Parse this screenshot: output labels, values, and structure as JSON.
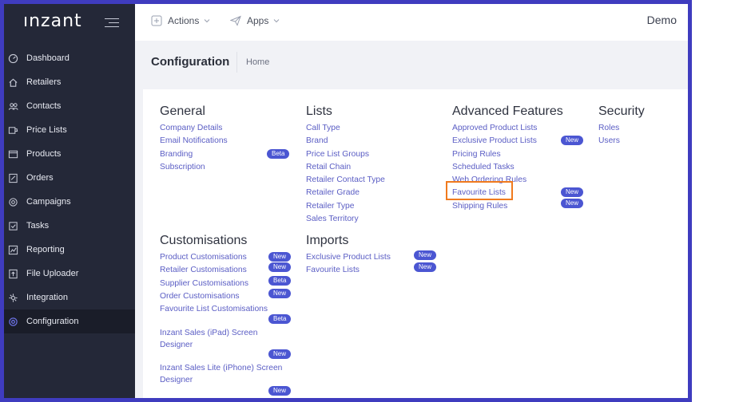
{
  "sidebar": {
    "logo": "ınzant",
    "items": [
      {
        "label": "Dashboard",
        "icon": "dashboard-icon"
      },
      {
        "label": "Retailers",
        "icon": "home-icon"
      },
      {
        "label": "Contacts",
        "icon": "contacts-icon"
      },
      {
        "label": "Price Lists",
        "icon": "price-list-icon"
      },
      {
        "label": "Products",
        "icon": "products-icon"
      },
      {
        "label": "Orders",
        "icon": "orders-icon"
      },
      {
        "label": "Campaigns",
        "icon": "campaigns-icon"
      },
      {
        "label": "Tasks",
        "icon": "tasks-icon"
      },
      {
        "label": "Reporting",
        "icon": "reporting-icon"
      },
      {
        "label": "File Uploader",
        "icon": "file-upload-icon"
      },
      {
        "label": "Integration",
        "icon": "integration-icon"
      },
      {
        "label": "Configuration",
        "icon": "gear-icon",
        "active": true
      }
    ]
  },
  "topbar": {
    "actions_label": "Actions",
    "apps_label": "Apps",
    "account_label": "Demo"
  },
  "header": {
    "title": "Configuration",
    "breadcrumb": "Home"
  },
  "sections": {
    "general": {
      "title": "General",
      "links": [
        {
          "label": "Company Details"
        },
        {
          "label": "Email Notifications"
        },
        {
          "label": "Branding",
          "badge": "Beta"
        },
        {
          "label": "Subscription"
        }
      ]
    },
    "lists": {
      "title": "Lists",
      "links": [
        {
          "label": "Call Type"
        },
        {
          "label": "Brand"
        },
        {
          "label": "Price List Groups"
        },
        {
          "label": "Retail Chain"
        },
        {
          "label": "Retailer Contact Type"
        },
        {
          "label": "Retailer Grade"
        },
        {
          "label": "Retailer Type"
        },
        {
          "label": "Sales Territory"
        }
      ]
    },
    "advanced": {
      "title": "Advanced Features",
      "links": [
        {
          "label": "Approved Product Lists"
        },
        {
          "label": "Exclusive Product Lists",
          "badge": "New"
        },
        {
          "label": "Pricing Rules"
        },
        {
          "label": "Scheduled Tasks"
        },
        {
          "label": "Web Ordering Rules"
        },
        {
          "label": "Favourite Lists",
          "badge": "New",
          "highlighted": true
        },
        {
          "label": "Shipping Rules",
          "badge": "New"
        }
      ]
    },
    "security": {
      "title": "Security",
      "links": [
        {
          "label": "Roles"
        },
        {
          "label": "Users"
        }
      ]
    },
    "customisations": {
      "title": "Customisations",
      "links": [
        {
          "label": "Product Customisations",
          "badge": "New"
        },
        {
          "label": "Retailer Customisations",
          "badge": "New"
        },
        {
          "label": "Supplier Customisations",
          "badge": "Beta"
        },
        {
          "label": "Order Customisations",
          "badge": "New"
        },
        {
          "label": "Favourite List Customisations",
          "badge": "Beta"
        },
        {
          "label": "Inzant Sales (iPad) Screen Designer",
          "badge": "New"
        },
        {
          "label": "Inzant Sales Lite (iPhone) Screen Designer",
          "badge": "New"
        }
      ]
    },
    "imports": {
      "title": "Imports",
      "links": [
        {
          "label": "Exclusive Product Lists",
          "badge": "New"
        },
        {
          "label": "Favourite Lists",
          "badge": "New"
        }
      ]
    }
  },
  "colors": {
    "frame": "#3f3cbf",
    "sidebar": "#242838",
    "link": "#5a5dc4",
    "badge": "#4b56d2",
    "highlight": "#f07a1e"
  }
}
